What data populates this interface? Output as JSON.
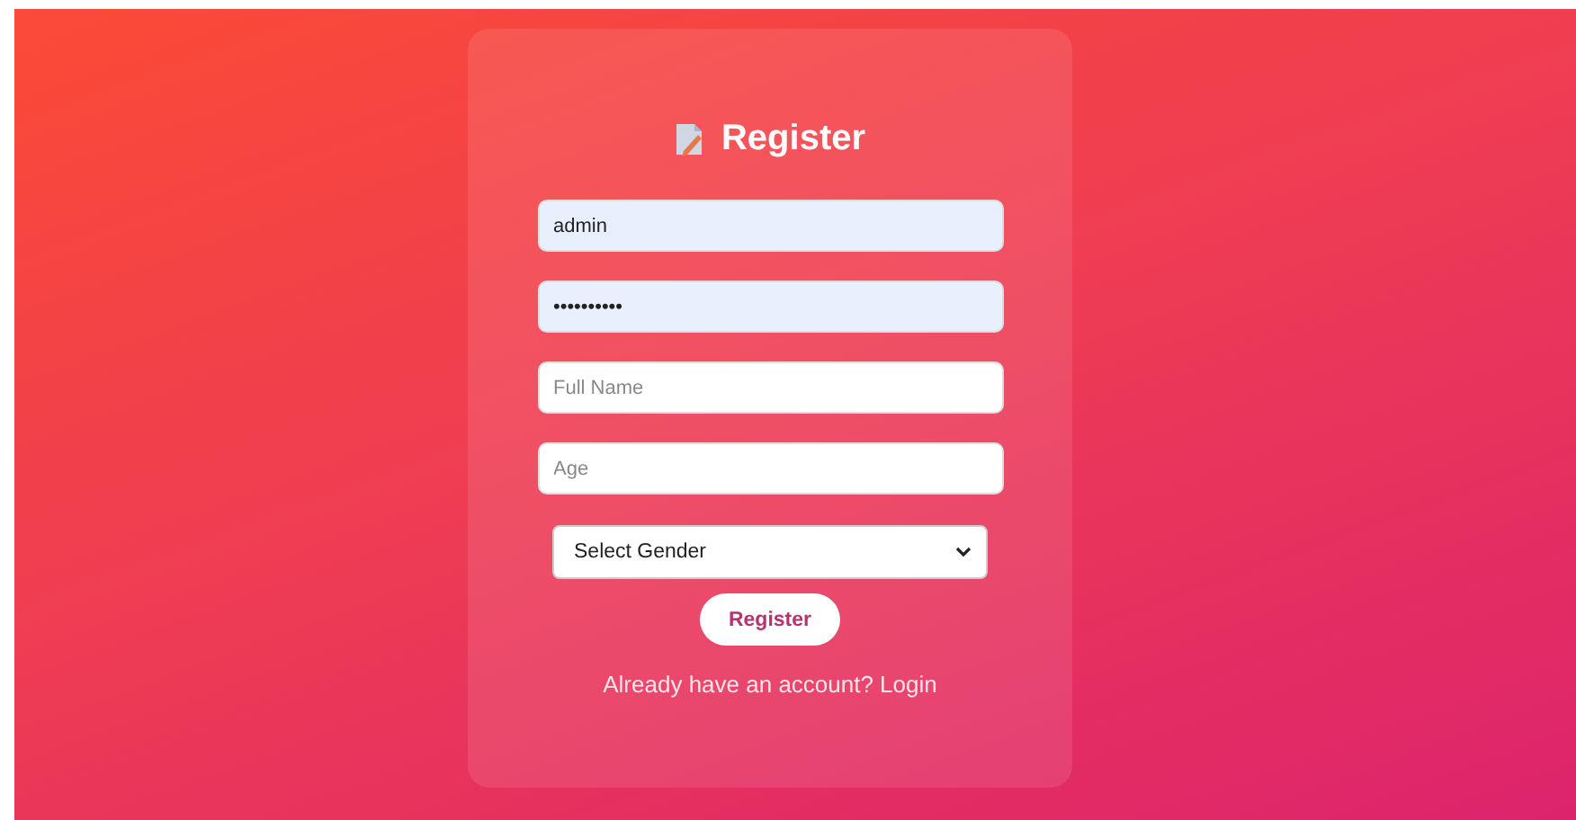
{
  "form": {
    "title": "Register",
    "fields": [
      {
        "kind": "text",
        "value": "admin"
      },
      {
        "kind": "password",
        "value": "••••••••••"
      },
      {
        "kind": "text",
        "placeholder": "Full Name"
      },
      {
        "kind": "text",
        "placeholder": "Age"
      },
      {
        "kind": "select",
        "value": "Select Gender"
      }
    ],
    "button": "Register",
    "link": "Already have an account? Login"
  }
}
